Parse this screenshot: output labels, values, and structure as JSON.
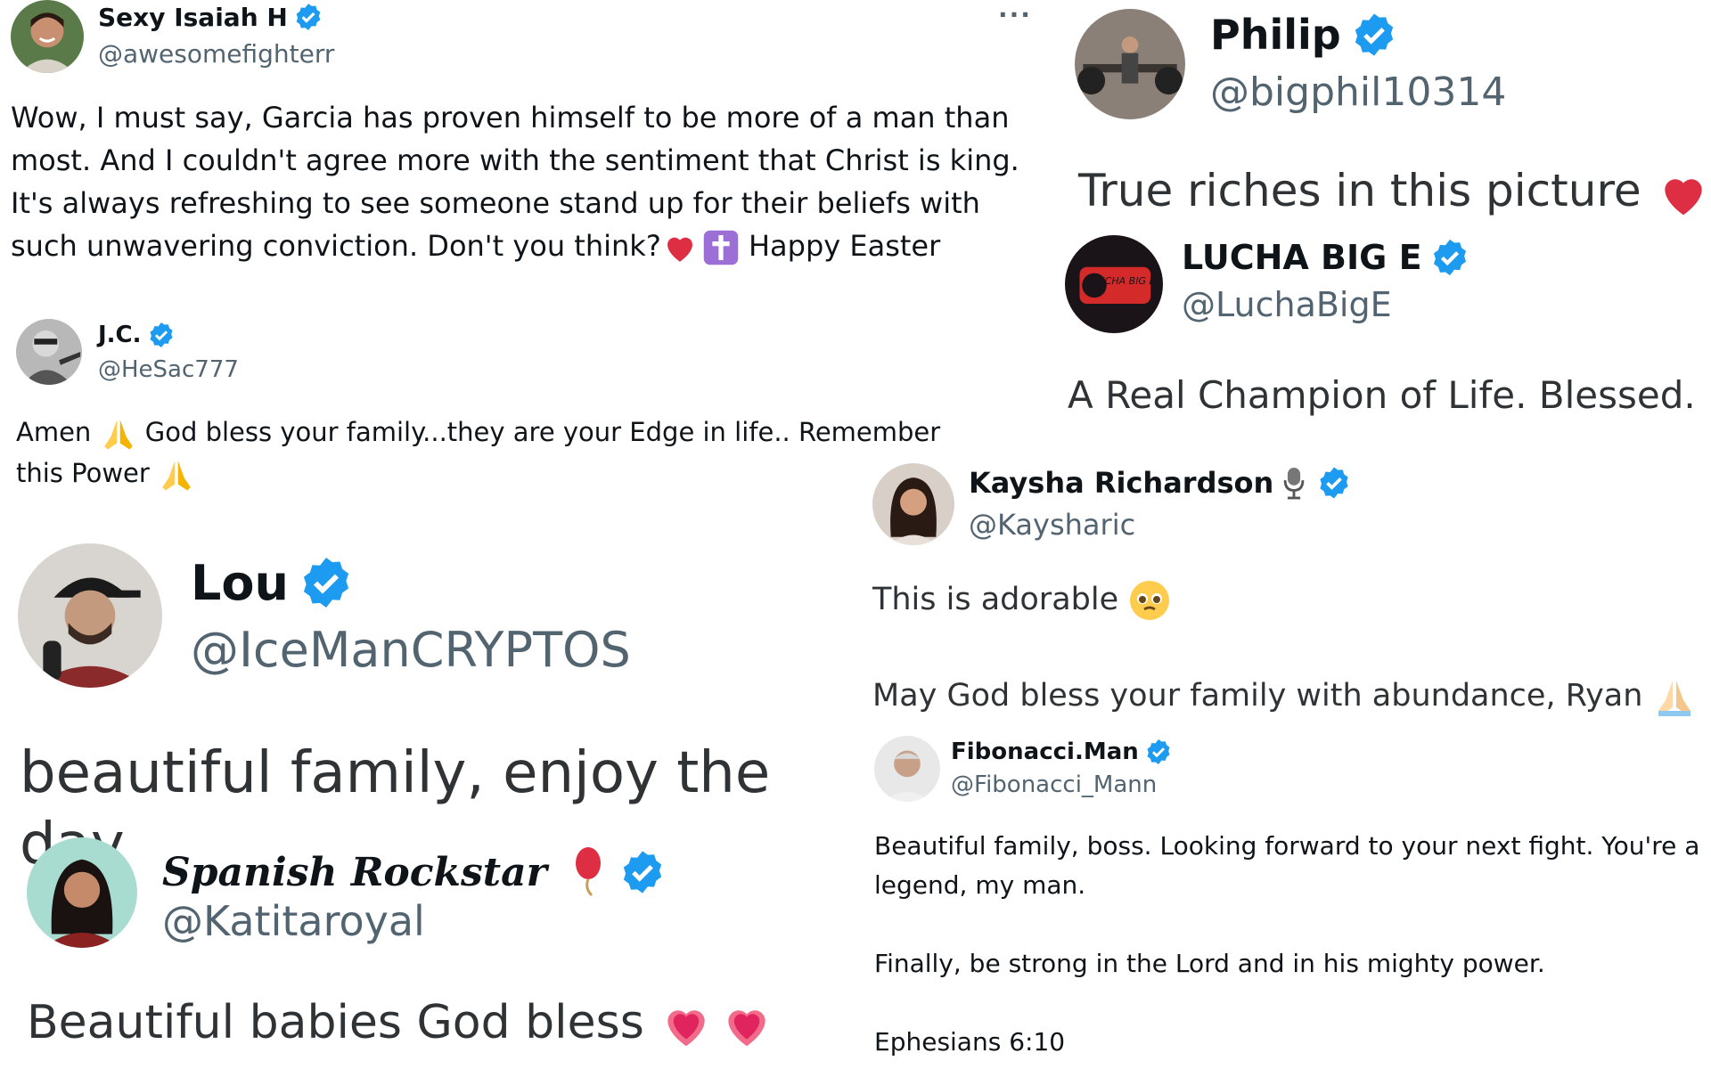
{
  "colors": {
    "verified": "#1d9bf0",
    "handle": "#536471",
    "text": "#0f1419",
    "heart": "#e0245e"
  },
  "tweets": [
    {
      "id": "isaiah",
      "name": "Sexy Isaiah H",
      "handle": "@awesomefighterr",
      "more_icon": "more-options-icon",
      "text_before": "Wow, I must say, Garcia has proven himself to be more of a man than most. And I couldn't agree more with the sentiment that Christ is king. It's always refreshing to see someone stand up for their beliefs with such unwavering conviction. Don't you think?",
      "emojis": [
        "red-heart-emoji",
        "latin-cross-emoji"
      ],
      "text_after": " Happy Easter"
    },
    {
      "id": "jc",
      "name": "J.C.",
      "handle": "@HeSac777",
      "text_1": "Amen ",
      "text_2": " God bless your family...they are your Edge in life.. Remember this Power ",
      "emojis": [
        "folded-hands-emoji",
        "folded-hands-emoji"
      ]
    },
    {
      "id": "lou",
      "name": "Lou",
      "handle": "@IceManCRYPTOS",
      "text": "beautiful family, enjoy the day"
    },
    {
      "id": "spanish",
      "name": "Spanish Rockstar",
      "name_emoji": "red-balloon-emoji",
      "handle": "@Katitaroyal",
      "text": "Beautiful babies God bless ",
      "emojis": [
        "heart-emoji",
        "heart-emoji"
      ]
    },
    {
      "id": "philip",
      "name": "Philip",
      "handle": "@bigphil10314",
      "text": "True riches in this picture ",
      "emojis": [
        "red-heart-emoji"
      ]
    },
    {
      "id": "lucha",
      "name": "LUCHA BIG E",
      "handle": "@LuchaBigE",
      "avatar_text": "LUCHA BIG E",
      "text": "A Real Champion of Life. Blessed."
    },
    {
      "id": "kaysha",
      "name": "Kaysha Richardson",
      "name_emoji": "microphone-emoji",
      "handle": "@Kaysharic",
      "text_1": "This is adorable ",
      "text_2": "May God bless your family with abundance, Ryan ",
      "emojis": [
        "pleading-face-emoji",
        "folded-hands-emoji"
      ]
    },
    {
      "id": "fibonacci",
      "name": "Fibonacci.Man",
      "handle": "@Fibonacci_Mann",
      "text_1": "Beautiful family, boss. Looking forward to your next fight. You're a legend, my man.",
      "text_2": "Finally, be strong in the Lord and in his mighty power.",
      "text_3": "Ephesians 6:10"
    }
  ]
}
